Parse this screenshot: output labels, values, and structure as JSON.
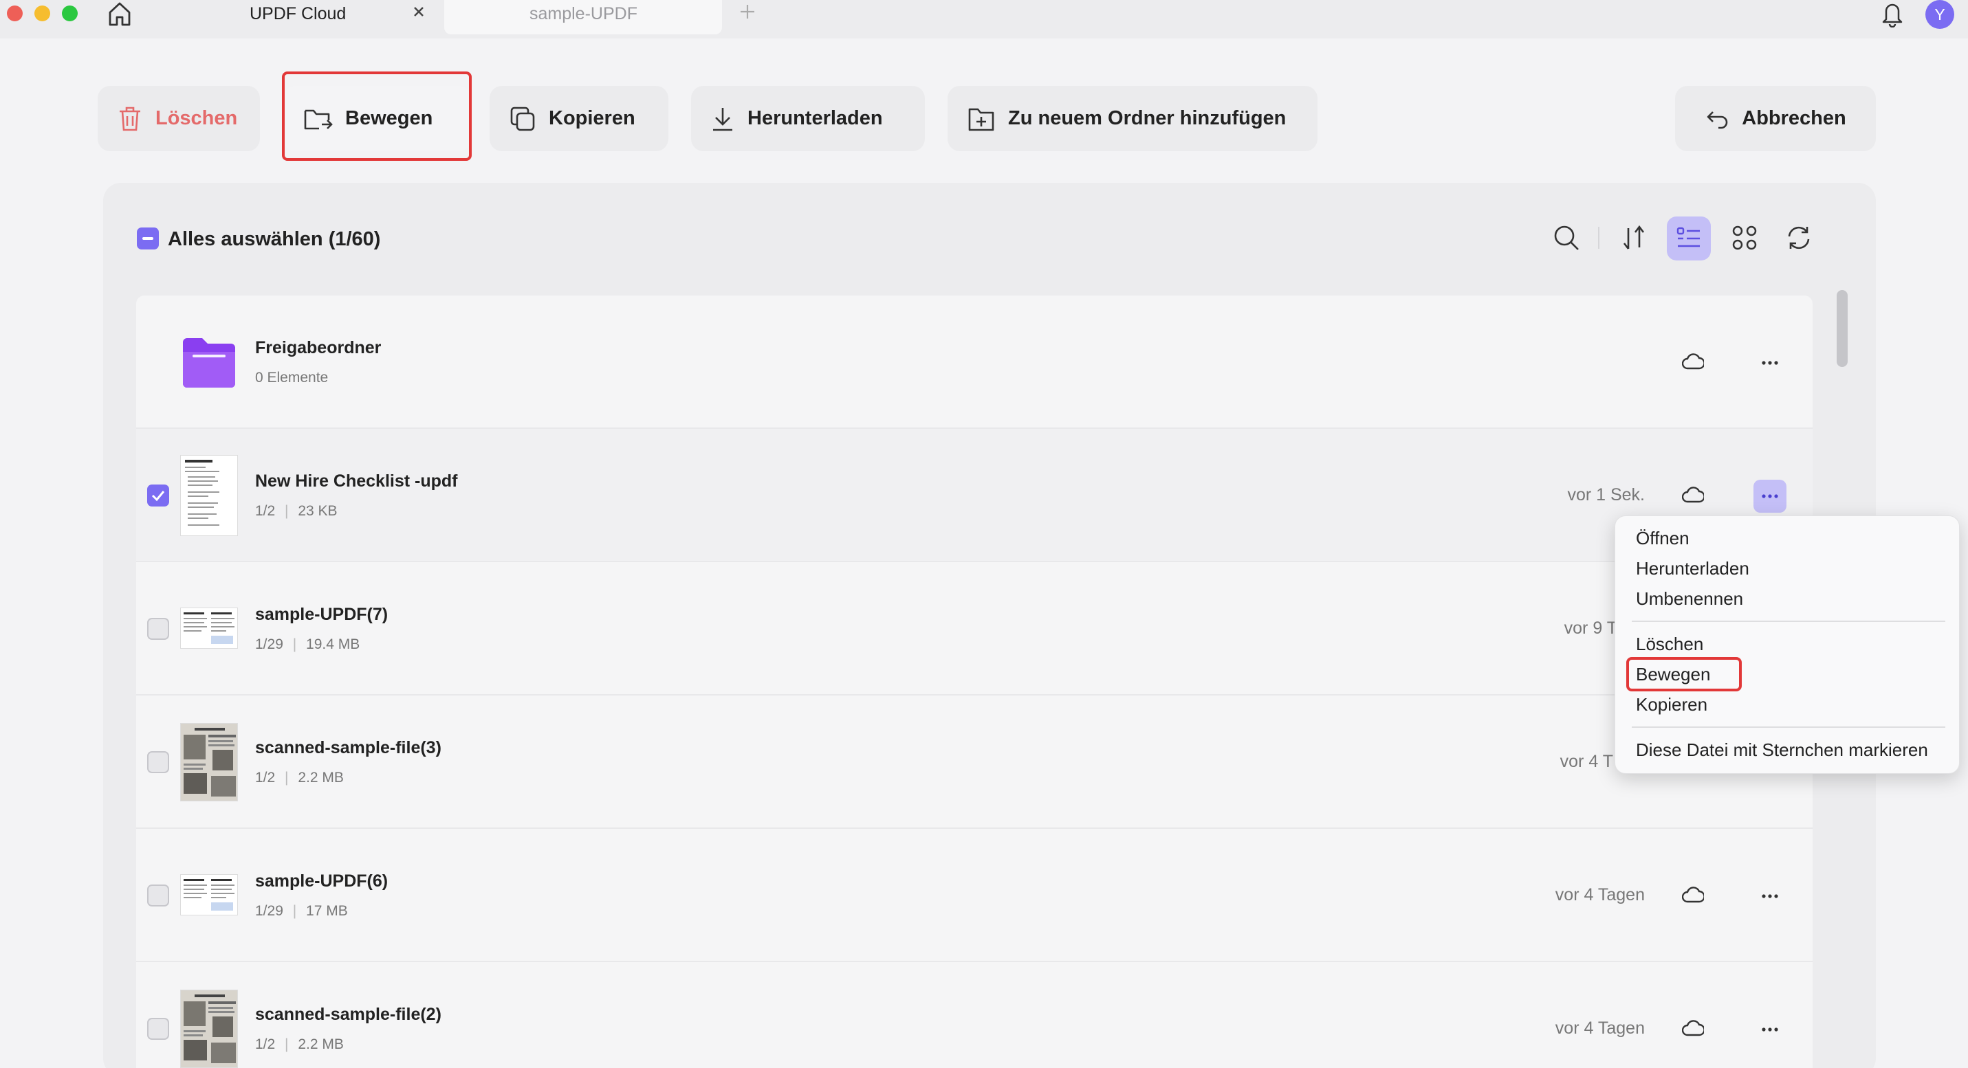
{
  "tabs": [
    {
      "label": "UPDF Cloud"
    },
    {
      "label": "sample-UPDF"
    }
  ],
  "user": {
    "avatar_letter": "Y"
  },
  "toolbar": {
    "delete_label": "Löschen",
    "move_label": "Bewegen",
    "copy_label": "Kopieren",
    "download_label": "Herunterladen",
    "add_folder_label": "Zu neuem Ordner hinzufügen",
    "cancel_label": "Abbrechen"
  },
  "selection": {
    "select_all_label": "Alles auswählen (1/60)"
  },
  "files": [
    {
      "name": "Freigabeordner",
      "meta": "0 Elemente",
      "date": "",
      "type": "folder",
      "checked": false
    },
    {
      "name": "New Hire Checklist -updf",
      "pages": "1/2",
      "size": "23 KB",
      "date": "vor 1 Sek.",
      "checked": true
    },
    {
      "name": "sample-UPDF(7)",
      "pages": "1/29",
      "size": "19.4 MB",
      "date": "vor 9 T",
      "checked": false
    },
    {
      "name": "scanned-sample-file(3)",
      "pages": "1/2",
      "size": "2.2 MB",
      "date": "vor 4 T",
      "checked": false
    },
    {
      "name": "sample-UPDF(6)",
      "pages": "1/29",
      "size": "17 MB",
      "date": "vor 4 Tagen",
      "checked": false
    },
    {
      "name": "scanned-sample-file(2)",
      "pages": "1/2",
      "size": "2.2 MB",
      "date": "vor 4 Tagen",
      "checked": false
    }
  ],
  "context_menu": {
    "items": [
      "Öffnen",
      "Herunterladen",
      "Umbenennen",
      "Löschen",
      "Bewegen",
      "Kopieren",
      "Diese Datei mit Sternchen markieren"
    ],
    "highlighted": "Bewegen"
  },
  "colors": {
    "accent": "#7b6cf2",
    "folder": "#8a3ff0",
    "delete": "#e46a6a",
    "highlight_border": "#e23838"
  },
  "icons": [
    "home-icon",
    "close-icon",
    "plus-icon",
    "bell-icon",
    "trash-icon",
    "move-icon",
    "copy-icon",
    "download-icon",
    "add-folder-icon",
    "undo-icon",
    "search-icon",
    "sort-icon",
    "list-view-icon",
    "grid-view-icon",
    "refresh-icon",
    "cloud-icon",
    "more-icon"
  ]
}
